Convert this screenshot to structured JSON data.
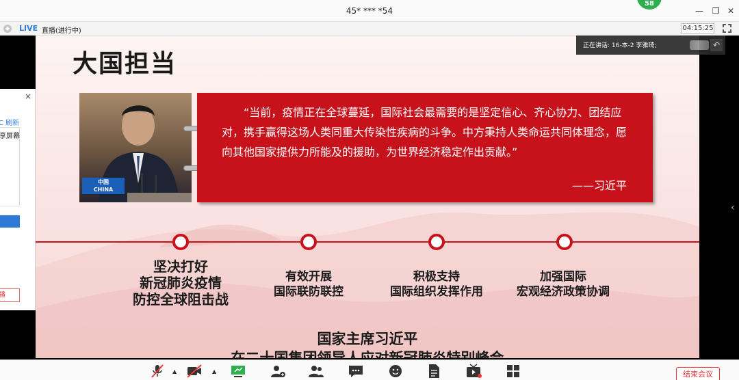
{
  "window": {
    "title": "45* *** *54",
    "participant_badge": "58"
  },
  "livebar": {
    "live_label": "LIVE",
    "status": "直播(进行中)",
    "timer": "04:15:25"
  },
  "left_panel": {
    "close": "×",
    "refresh": "C 刷新",
    "share": "享屏幕",
    "red_button": "播"
  },
  "speaking": {
    "text": "正在讲话: 16-本-2 李雅琦;"
  },
  "slide": {
    "title": "大国担当",
    "sign_cn": "中国",
    "sign_en": "CHINA",
    "quote": "“当前，疫情正在全球蔓延，国际社会最需要的是坚定信心、齐心协力、团结应对，携手赢得这场人类同重大传染性疾病的斗争。中方秉持人类命运共同体理念，愿向其他国家提供力所能及的援助，为世界经济稳定作出贡献。”",
    "author": "——习近平",
    "points": [
      {
        "lines": [
          "坚决打好",
          "新冠肺炎疫情",
          "防控全球阻击战"
        ]
      },
      {
        "lines": [
          "有效开展",
          "国际联防联控"
        ]
      },
      {
        "lines": [
          "积极支持",
          "国际组织发挥作用"
        ]
      },
      {
        "lines": [
          "加强国际",
          "宏观经济政策协调"
        ]
      }
    ],
    "bottom_line1": "国家主席习近平",
    "bottom_line2": "在二十国集团领导人应对新冠肺炎特别峰会"
  },
  "toolbar": {
    "end_label": "结束会议"
  },
  "colors": {
    "accent_red": "#c7121c",
    "live_blue": "#2e7ad6",
    "badge_green": "#2fae4e"
  }
}
